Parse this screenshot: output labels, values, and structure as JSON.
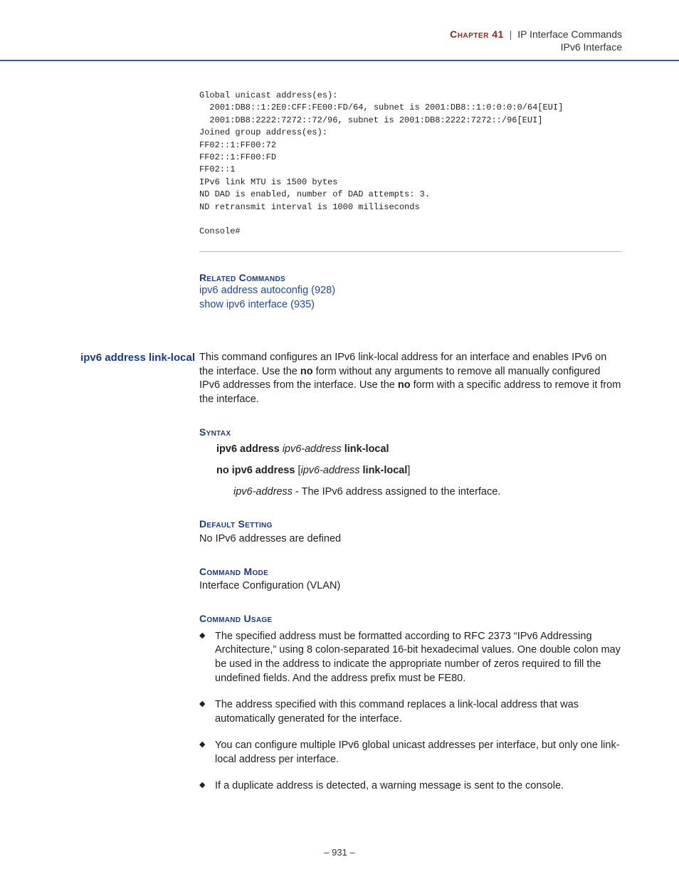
{
  "header": {
    "chapter_label": "Chapter 41",
    "category": "IP Interface Commands",
    "subcategory": "IPv6 Interface"
  },
  "console": {
    "lines": "Global unicast address(es):\n  2001:DB8::1:2E0:CFF:FE00:FD/64, subnet is 2001:DB8::1:0:0:0:0/64[EUI]\n  2001:DB8:2222:7272::72/96, subnet is 2001:DB8:2222:7272::/96[EUI]\nJoined group address(es):\nFF02::1:FF00:72\nFF02::1:FF00:FD\nFF02::1\nIPv6 link MTU is 1500 bytes\nND DAD is enabled, number of DAD attempts: 3.\nND retransmit interval is 1000 milliseconds\n\nConsole#"
  },
  "related": {
    "heading": "Related Commands",
    "links": [
      "ipv6 address autoconfig (928)",
      "show ipv6 interface (935)"
    ]
  },
  "command": {
    "name": "ipv6 address link-local",
    "desc_pre": "This command configures an IPv6 link-local address for an interface and enables IPv6 on the interface. Use the ",
    "no1": "no",
    "desc_mid": " form without any arguments to remove all manually configured IPv6 addresses from the interface. Use the ",
    "no2": "no",
    "desc_post": " form with a specific address to remove it from the interface."
  },
  "syntax": {
    "heading": "Syntax",
    "line1_bold1": "ipv6 address ",
    "line1_italic": "ipv6-address",
    "line1_bold2": " link-local",
    "line2_bold1": "no ipv6 address ",
    "line2_bracket_open": "[",
    "line2_italic": "ipv6-address",
    "line2_bold2": " link-local",
    "line2_bracket_close": "]",
    "param_italic": "ipv6-address",
    "param_text": " - The IPv6 address assigned to the interface."
  },
  "default_setting": {
    "heading": "Default Setting",
    "body": "No IPv6 addresses are defined"
  },
  "command_mode": {
    "heading": "Command Mode",
    "body": "Interface Configuration (VLAN)"
  },
  "command_usage": {
    "heading": "Command Usage",
    "items": [
      "The specified address must be formatted according to RFC 2373 “IPv6 Addressing Architecture,” using 8 colon-separated 16-bit hexadecimal values. One double colon may be used in the address to indicate the appropriate number of zeros required to fill the undefined fields. And the address prefix must be FE80.",
      "The address specified with this command replaces a link-local address that was automatically generated for the interface.",
      "You can configure multiple IPv6 global unicast addresses per interface, but only one link-local address per interface.",
      "If a duplicate address is detected, a warning message is sent to the console."
    ]
  },
  "page_number": "– 931 –"
}
